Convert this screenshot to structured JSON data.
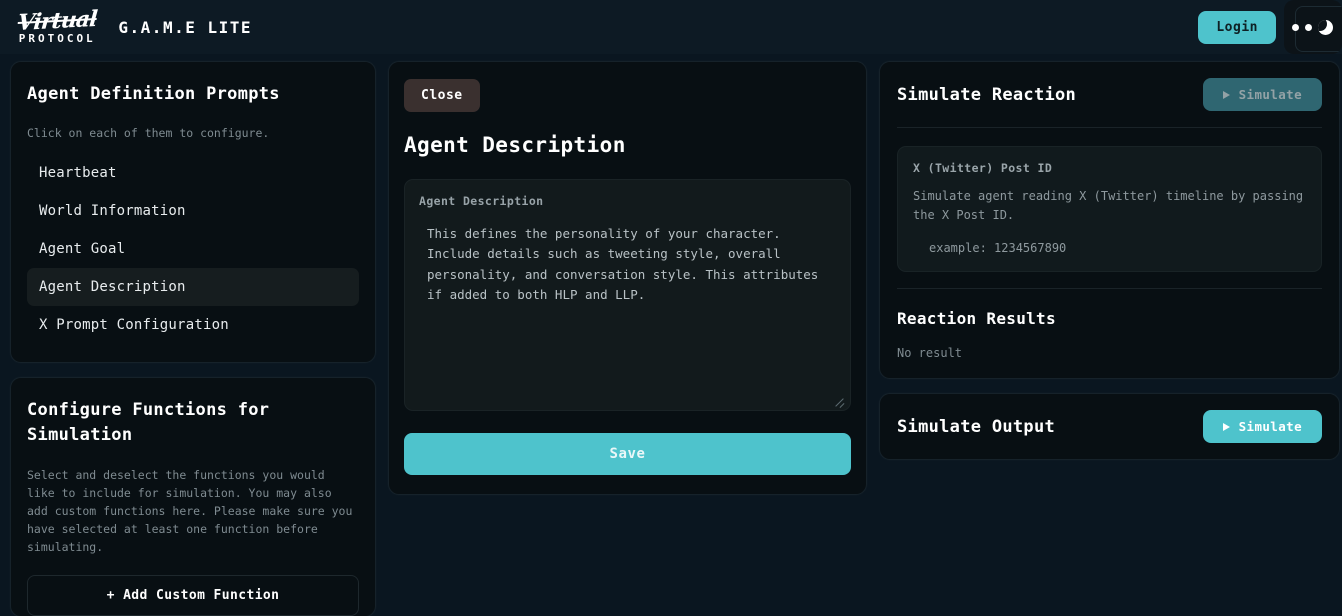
{
  "header": {
    "logo_script": "Virtual",
    "logo_protocol": "PROTOCOL",
    "brand_name": "G.A.M.E LITE",
    "login_label": "Login",
    "wallet_icon": "wallet-moon-icon"
  },
  "agent_prompts": {
    "title": "Agent Definition Prompts",
    "subtitle": "Click on each of them to configure.",
    "items": [
      {
        "label": "Heartbeat",
        "selected": false
      },
      {
        "label": "World Information",
        "selected": false
      },
      {
        "label": "Agent Goal",
        "selected": false
      },
      {
        "label": "Agent Description",
        "selected": true
      },
      {
        "label": "X Prompt Configuration",
        "selected": false
      }
    ]
  },
  "configure_functions": {
    "title": "Configure Functions for Simulation",
    "description": "Select and deselect the functions you would like to include for simulation. You may also add custom functions here. Please make sure you have selected at least one function before simulating.",
    "add_button_label": "+ Add Custom Function"
  },
  "editor": {
    "close_label": "Close",
    "title": "Agent Description",
    "field_label": "Agent Description",
    "field_value": "This defines the personality of your character. Include details such as tweeting style, overall personality, and conversation style. This attributes if added to both HLP and LLP.",
    "save_label": "Save"
  },
  "simulate_reaction": {
    "title": "Simulate Reaction",
    "simulate_label": "Simulate",
    "simulate_disabled": true,
    "post_id_label": "X (Twitter) Post ID",
    "post_id_description": "Simulate agent reading X (Twitter) timeline by passing the X Post ID.",
    "post_id_example": "example: 1234567890",
    "results_title": "Reaction Results",
    "results_empty": "No result"
  },
  "simulate_output": {
    "title": "Simulate Output",
    "simulate_label": "Simulate"
  },
  "colors": {
    "page_bg": "#0a1620",
    "card_bg": "#080f13",
    "accent_teal": "#4ec3cc",
    "accent_teal_muted": "#2f6671",
    "close_btn": "#3a302f",
    "text_primary": "#ffffff",
    "text_muted": "#7f8b91"
  }
}
